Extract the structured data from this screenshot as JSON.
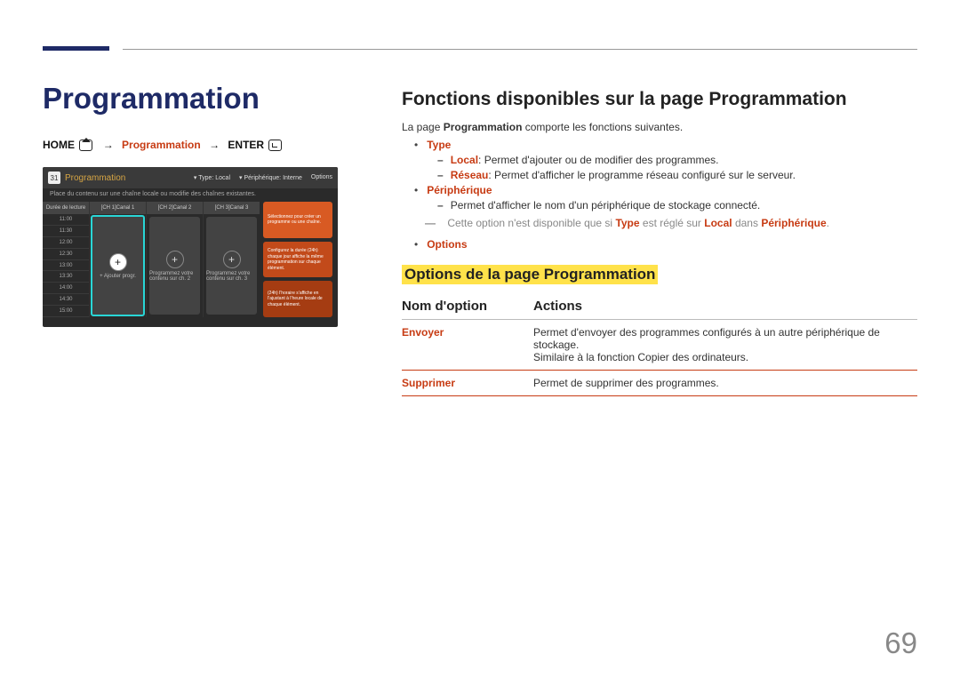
{
  "page_number": "69",
  "title": "Programmation",
  "breadcrumb": {
    "home": "HOME",
    "mid": "Programmation",
    "enter": "ENTER"
  },
  "screenshot": {
    "date_icon": "31",
    "header": "Programmation",
    "subheader": "Place du contenu sur une chaîne locale ou modifie des chaînes existantes.",
    "menu_type_label": "Type: Local",
    "menu_periph_label": "Périphérique: Interne",
    "menu_options": "Options",
    "time_header": "Durée de lecture",
    "times": [
      "11:00",
      "11:30",
      "12:00",
      "12:30",
      "13:00",
      "13:30",
      "14:00",
      "14:30",
      "15:00"
    ],
    "channels": [
      {
        "head": "[CH 1]Canal 1",
        "label": "+ Ajouter progr."
      },
      {
        "head": "[CH 2]Canal 2",
        "label": "Programmez votre contenu sur ch. 2"
      },
      {
        "head": "[CH 3]Canal 3",
        "label": "Programmez votre contenu sur ch. 3"
      }
    ],
    "side_cards": [
      "Sélectionnez pour créer un programme ou une chaîne.",
      "Configurez la durée (24h) chaque jour affiche la même programmation sur chaque élément.",
      "(24h) l’horaire s’affiche en l’ajustant à l’heure locale de chaque élément."
    ]
  },
  "section_h2": "Fonctions disponibles sur la page Programmation",
  "intro_pre": "La page ",
  "intro_bold": "Programmation",
  "intro_post": " comporte les fonctions suivantes.",
  "items": {
    "type": {
      "label": "Type",
      "local_b": "Local",
      "local_txt": ": Permet d'ajouter ou de modifier des programmes.",
      "reseau_b": "Réseau",
      "reseau_txt": ": Permet d'afficher le programme réseau configuré sur le serveur."
    },
    "periph": {
      "label": "Périphérique",
      "line1": "Permet d'afficher le nom d'un périphérique de stockage connecté.",
      "note_pre": "Cette option n'est disponible que si ",
      "note_type": "Type",
      "note_mid": " est réglé sur ",
      "note_local": "Local",
      "note_dans": " dans ",
      "note_periph": "Périphérique",
      "note_dot": "."
    },
    "options": {
      "label": "Options"
    }
  },
  "h3": "Options de la page Programmation",
  "table": {
    "col1": "Nom d'option",
    "col2": "Actions",
    "rows": [
      {
        "opt": "Envoyer",
        "act_l1": "Permet d'envoyer des programmes configurés à un autre périphérique de stockage.",
        "act_l2": "Similaire à la fonction Copier des ordinateurs."
      },
      {
        "opt": "Supprimer",
        "act_l1": "Permet de supprimer des programmes."
      }
    ]
  }
}
